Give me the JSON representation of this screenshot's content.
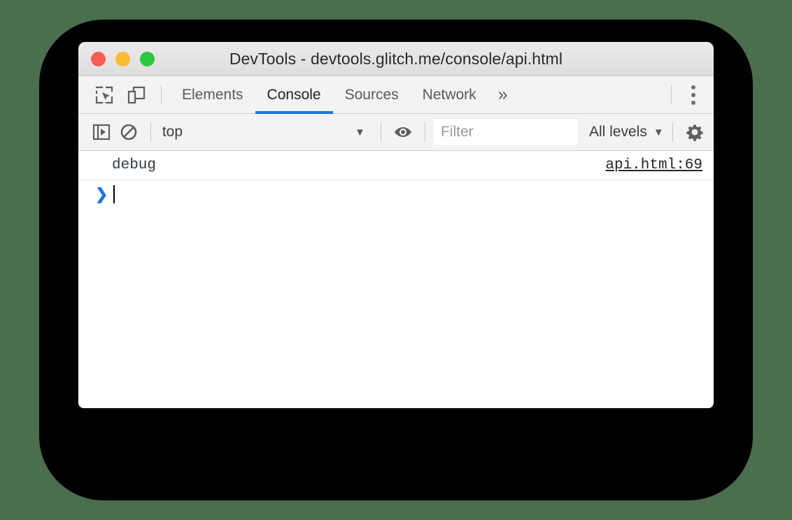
{
  "window": {
    "title": "DevTools - devtools.glitch.me/console/api.html",
    "traffic_lights": [
      {
        "name": "close",
        "color": "#fb5c54"
      },
      {
        "name": "minimize",
        "color": "#f9bd2f"
      },
      {
        "name": "zoom",
        "color": "#2ac73f"
      }
    ]
  },
  "tab_bar": {
    "inspect_icon": "inspect-element-icon",
    "device_icon": "device-toolbar-icon",
    "tabs": [
      {
        "label": "Elements",
        "active": false
      },
      {
        "label": "Console",
        "active": true
      },
      {
        "label": "Sources",
        "active": false
      },
      {
        "label": "Network",
        "active": false
      }
    ],
    "more_tabs_label": "»",
    "more_options_icon": "more-vertical-icon",
    "active_tab_color": "#1a73e8"
  },
  "console_toolbar": {
    "sidebar_icon": "console-sidebar-icon",
    "clear_icon": "clear-console-icon",
    "context": {
      "value": "top",
      "caret": "▼"
    },
    "eye_icon": "live-expression-eye-icon",
    "filter": {
      "value": "",
      "placeholder": "Filter"
    },
    "levels": {
      "value": "All levels",
      "caret": "▼"
    },
    "settings_icon": "settings-gear-icon"
  },
  "console": {
    "messages": [
      {
        "text": "debug",
        "source": "api.html:69"
      }
    ],
    "prompt": {
      "arrow": "❯",
      "value": ""
    }
  },
  "colors": {
    "backdrop": "#4b6e4c",
    "card": "#000000",
    "window_bg": "#ffffff",
    "toolbar_bg": "#f3f3f3",
    "accent": "#1a73e8"
  }
}
